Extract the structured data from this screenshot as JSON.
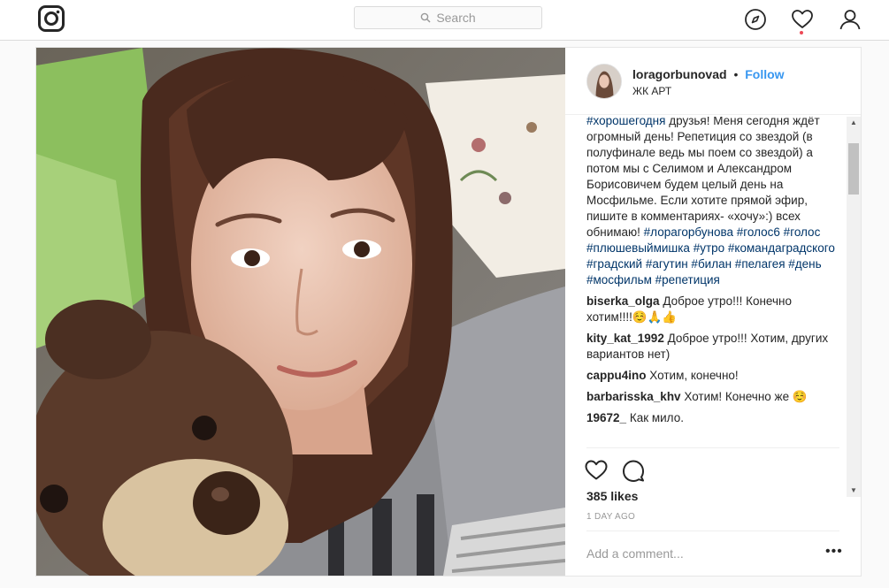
{
  "nav": {
    "logo_icon": "instagram-camera-icon",
    "search_placeholder": "Search",
    "search_icon": "search-icon",
    "icons": [
      "compass-icon",
      "heart-icon",
      "user-icon"
    ],
    "notification_color": "#ed4956"
  },
  "post": {
    "username": "loragorbunovad",
    "separator": "•",
    "follow_label": "Follow",
    "location": "ЖК АРТ",
    "caption_text": "#хорошегодня друзья! Меня сегодня ждёт огромный день! Репетиция со звездой (в полуфинале ведь мы поем со звездой) а потом мы с Селимом и Александром Борисовичем будем целый день на Мосфильме. Если хотите прямой эфир, пишите в комментариях- «хочу»:) всех обнимаю! ",
    "hashtags_first": "#хорошегодня",
    "caption_body": " друзья! Меня сегодня ждёт огромный день! Репетиция со звездой (в полуфинале ведь мы поем со звездой) а потом мы с Селимом и Александром Борисовичем будем целый день на Мосфильме. Если хотите прямой эфир, пишите в комментариях- «хочу»:) всех обнимаю! ",
    "hashtags": "#лорагорбунова #голос6 #голос #плюшевыймишка #утро #командаградского #градский #агутин #билан #пелагея #день #мосфильм #репетиция",
    "comments": [
      {
        "user": "biserka_olga",
        "text": "Доброе утро!!! Конечно хотим!!!!☺️🙏👍"
      },
      {
        "user": "kity_kat_1992",
        "text": "Доброе утро!!! Хотим, других вариантов нет)"
      },
      {
        "user": "cappu4ino",
        "text": "Хотим, конечно!"
      },
      {
        "user": "barbarisska_khv",
        "text": "Хотим! Конечно же ☺️"
      },
      {
        "user": "19672_",
        "text": "Как мило."
      }
    ],
    "likes": "385 likes",
    "timestamp": "1 DAY AGO",
    "add_comment_placeholder": "Add a comment...",
    "more_label": "•••",
    "accent_color": "#3897f0"
  }
}
